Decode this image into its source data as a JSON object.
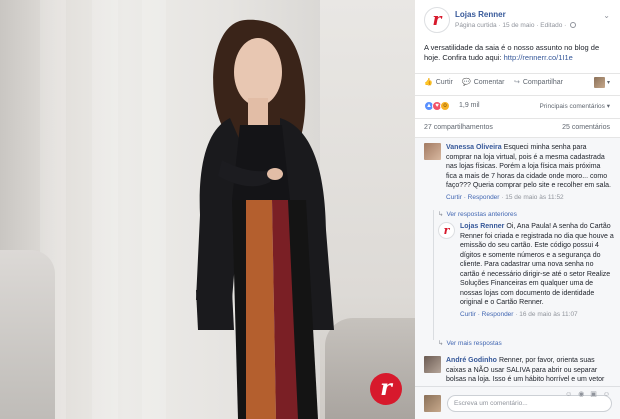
{
  "post": {
    "page_name": "Lojas Renner",
    "meta": "Página curtida · 15 de maio · Editado ·",
    "text_main": "A versatilidade da saia é o nosso assunto no blog de hoje. Confira tudo aqui: ",
    "link": "http://rennerr.co/1I1e"
  },
  "actions": {
    "like": "Curtir",
    "comment": "Comentar",
    "share": "Compartilhar"
  },
  "reactions": {
    "count": "1,9 mil",
    "sort_label": "Principais comentários ▾"
  },
  "stats": {
    "shares": "27 compartilhamentos",
    "comments": "25 comentários"
  },
  "comments": [
    {
      "author": "Vanessa Oliveira",
      "text": "Esqueci minha senha para comprar na loja virtual, pois é a mesma cadastrada nas lojas físicas. Porém a loja física mais próxima fica a mais de 7 horas da cidade onde moro... como faço??? Queria comprar pelo site e recolher em sala.",
      "meta_actions": "Curtir · Responder",
      "meta_time": "· 15 de maio às 11:52",
      "see_replies": "Ver respostas anteriores"
    },
    {
      "author": "Lojas Renner",
      "text": "Oi, Ana Paula! A senha do Cartão Renner foi criada e registrada no dia que houve a emissão do seu cartão. Este código possui 4 dígitos e somente números e a segurança do cliente. Para cadastrar uma nova senha no cartão é necessário dirigir-se até o setor Realize Soluções Financeiras em qualquer uma de nossas lojas com documento de identidade original e o Cartão Renner.",
      "meta_actions": "Curtir · Responder",
      "meta_time": "· 16 de maio às 11:07",
      "see_replies": "Ver mais respostas"
    },
    {
      "author": "André Godinho",
      "text": "Renner, por favor, orienta suas caixas a NÃO usar SALIVA para abrir ou separar bolsas na loja. Isso é um hábito horrível e um vetor de doenças diversas."
    }
  ],
  "composer": {
    "placeholder": "Escreva um comentário...",
    "icons": "☺ ◉ ▣ ☺"
  },
  "brand": {
    "logo_letter": "r",
    "accent": "#d7192c",
    "link_color": "#365899"
  }
}
